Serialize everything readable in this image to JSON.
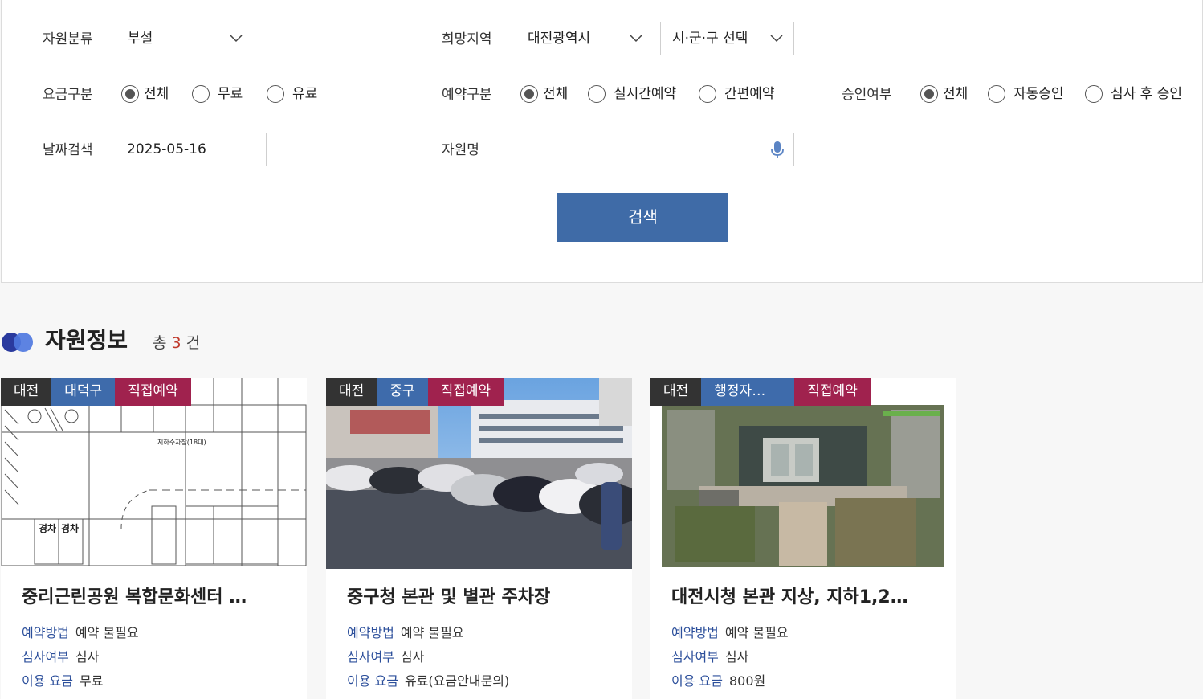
{
  "filters": {
    "resource_type": {
      "label": "자원분류",
      "value": "부설"
    },
    "region": {
      "label": "희망지역",
      "city": "대전광역시",
      "district_placeholder": "시·군·구 선택"
    },
    "fee_type": {
      "label": "요금구분",
      "options": [
        "전체",
        "무료",
        "유료"
      ],
      "selected": "전체"
    },
    "booking_type": {
      "label": "예약구분",
      "options": [
        "전체",
        "실시간예약",
        "간편예약"
      ],
      "selected": "전체"
    },
    "approval": {
      "label": "승인여부",
      "options": [
        "전체",
        "자동승인",
        "심사 후 승인"
      ],
      "selected": "전체"
    },
    "date_search": {
      "label": "날짜검색",
      "value": "2025-05-16"
    },
    "resource_name": {
      "label": "자원명",
      "value": ""
    },
    "search_button": "검색"
  },
  "results": {
    "title": "자원정보",
    "total_prefix": "총",
    "total_count": "3",
    "total_suffix": "건"
  },
  "cards": [
    {
      "badges": [
        "대전",
        "대덕구",
        "직접예약"
      ],
      "title": "중리근린공원 복합문화센터 …",
      "booking_method_label": "예약방법",
      "booking_method": "예약 불필요",
      "review_label": "심사여부",
      "review": "심사",
      "fee_label": "이용 요금",
      "fee": "무료",
      "image": "parking-floor-plan",
      "plan_labels": {
        "lot": "지하주차장(18대)",
        "compact": "경차"
      }
    },
    {
      "badges": [
        "대전",
        "중구",
        "직접예약"
      ],
      "title": "중구청 본관 및 별관 주차장",
      "booking_method_label": "예약방법",
      "booking_method": "예약 불필요",
      "review_label": "심사여부",
      "review": "심사",
      "fee_label": "이용 요금",
      "fee": "유료(요금안내문의)",
      "image": "parking-lot-photo"
    },
    {
      "badges": [
        "대전",
        "행정자…",
        "직접예약"
      ],
      "title": "대전시청 본관 지상, 지하1,2…",
      "booking_method_label": "예약방법",
      "booking_method": "예약 불필요",
      "review_label": "심사여부",
      "review": "심사",
      "fee_label": "이용 요금",
      "fee": "800원",
      "image": "aerial-photo"
    }
  ],
  "colors": {
    "accent_blue": "#3f6ba7",
    "badge_dark": "#333333",
    "badge_blue": "#3e6bab",
    "badge_red": "#a0224e",
    "count_red": "#c0392b",
    "info_key": "#2c4f9b"
  }
}
